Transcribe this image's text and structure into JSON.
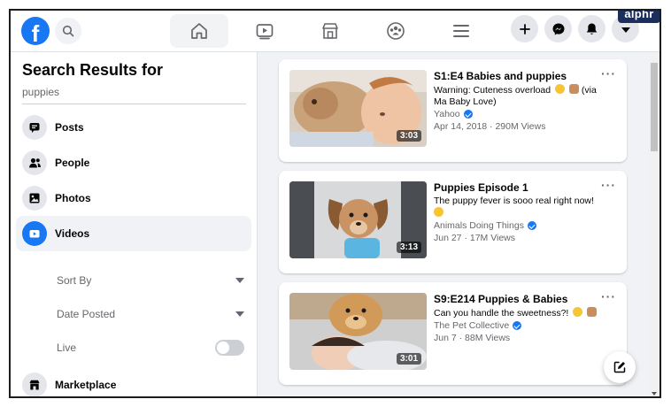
{
  "watermark": "alphr",
  "brand": {
    "logo_letter": "f",
    "color": "#1877f2"
  },
  "nav": {
    "tabs": [
      "home",
      "watch",
      "marketplace",
      "groups",
      "menu"
    ],
    "active_tab": "home",
    "actions": [
      "create",
      "messenger",
      "notifications",
      "account"
    ]
  },
  "sidebar": {
    "title": "Search Results for",
    "query": "puppies",
    "items": [
      {
        "label": "Posts",
        "icon": "posts-icon"
      },
      {
        "label": "People",
        "icon": "people-icon"
      },
      {
        "label": "Photos",
        "icon": "photos-icon"
      },
      {
        "label": "Videos",
        "icon": "videos-icon",
        "active": true
      }
    ],
    "filters": {
      "sort_by": "Sort By",
      "date_posted": "Date Posted",
      "live": "Live",
      "live_on": false
    },
    "marketplace": "Marketplace"
  },
  "results": [
    {
      "title": "S1:E4 Babies and puppies",
      "description": "Warning: Cuteness overload",
      "description_tail": "(via Ma Baby Love)",
      "source": "Yahoo",
      "verified": true,
      "meta": "Apr 14, 2018 · 290M Views",
      "duration": "3:03"
    },
    {
      "title": "Puppies Episode 1",
      "description": "The puppy fever is sooo real right now!",
      "source": "Animals Doing Things",
      "verified": true,
      "meta": "Jun 27 · 17M Views",
      "duration": "3:13"
    },
    {
      "title": "S9:E214 Puppies & Babies",
      "description": "Can you handle the sweetness?!",
      "source": "The Pet Collective",
      "verified": true,
      "meta": "Jun 7 · 88M Views",
      "duration": "3:01"
    }
  ],
  "more_label": "···"
}
